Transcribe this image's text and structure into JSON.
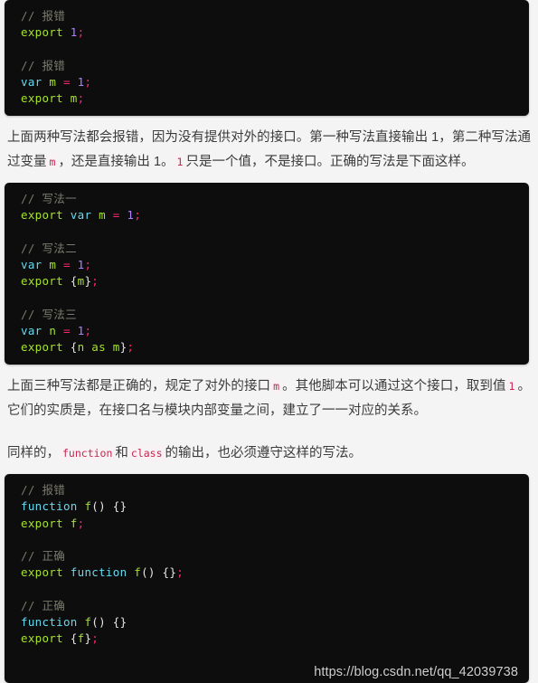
{
  "page": {
    "background_color": "#f4f4f4",
    "code_background_color": "#0d0d0d",
    "text_color": "#3b3b3b",
    "inline_code_color": "#c7254e",
    "inline_code_background": "#f9f2f4"
  },
  "code_block_1": {
    "lines": [
      {
        "segments": [
          {
            "t": "// 报错",
            "c": "com"
          }
        ]
      },
      {
        "segments": [
          {
            "t": "export",
            "c": "exp"
          },
          {
            "t": " ",
            "c": "pun"
          },
          {
            "t": "1",
            "c": "num"
          },
          {
            "t": ";",
            "c": "op"
          }
        ]
      },
      {
        "segments": []
      },
      {
        "segments": [
          {
            "t": "// 报错",
            "c": "com"
          }
        ]
      },
      {
        "segments": [
          {
            "t": "var",
            "c": "kw"
          },
          {
            "t": " ",
            "c": "pun"
          },
          {
            "t": "m",
            "c": "var"
          },
          {
            "t": " ",
            "c": "pun"
          },
          {
            "t": "=",
            "c": "op"
          },
          {
            "t": " ",
            "c": "pun"
          },
          {
            "t": "1",
            "c": "num"
          },
          {
            "t": ";",
            "c": "op"
          }
        ]
      },
      {
        "segments": [
          {
            "t": "export",
            "c": "exp"
          },
          {
            "t": " ",
            "c": "pun"
          },
          {
            "t": "m",
            "c": "var"
          },
          {
            "t": ";",
            "c": "op"
          }
        ]
      }
    ]
  },
  "paragraph_1": {
    "parts": [
      {
        "t": "上面两种写法都会报错，因为没有提供对外的接口。第一种写法直接输出 1，第二种写法通过变量",
        "code": false
      },
      {
        "t": "m",
        "code": true
      },
      {
        "t": "，还是直接输出 1。",
        "code": false
      },
      {
        "t": "1",
        "code": true
      },
      {
        "t": "只是一个值，不是接口。正确的写法是下面这样。",
        "code": false
      }
    ]
  },
  "code_block_2": {
    "lines": [
      {
        "segments": [
          {
            "t": "// 写法一",
            "c": "com"
          }
        ]
      },
      {
        "segments": [
          {
            "t": "export",
            "c": "exp"
          },
          {
            "t": " ",
            "c": "pun"
          },
          {
            "t": "var",
            "c": "kw"
          },
          {
            "t": " ",
            "c": "pun"
          },
          {
            "t": "m",
            "c": "var"
          },
          {
            "t": " ",
            "c": "pun"
          },
          {
            "t": "=",
            "c": "op"
          },
          {
            "t": " ",
            "c": "pun"
          },
          {
            "t": "1",
            "c": "num"
          },
          {
            "t": ";",
            "c": "op"
          }
        ]
      },
      {
        "segments": []
      },
      {
        "segments": [
          {
            "t": "// 写法二",
            "c": "com"
          }
        ]
      },
      {
        "segments": [
          {
            "t": "var",
            "c": "kw"
          },
          {
            "t": " ",
            "c": "pun"
          },
          {
            "t": "m",
            "c": "var"
          },
          {
            "t": " ",
            "c": "pun"
          },
          {
            "t": "=",
            "c": "op"
          },
          {
            "t": " ",
            "c": "pun"
          },
          {
            "t": "1",
            "c": "num"
          },
          {
            "t": ";",
            "c": "op"
          }
        ]
      },
      {
        "segments": [
          {
            "t": "export",
            "c": "exp"
          },
          {
            "t": " ",
            "c": "pun"
          },
          {
            "t": "{",
            "c": "pun"
          },
          {
            "t": "m",
            "c": "var"
          },
          {
            "t": "}",
            "c": "pun"
          },
          {
            "t": ";",
            "c": "op"
          }
        ]
      },
      {
        "segments": []
      },
      {
        "segments": [
          {
            "t": "// 写法三",
            "c": "com"
          }
        ]
      },
      {
        "segments": [
          {
            "t": "var",
            "c": "kw"
          },
          {
            "t": " ",
            "c": "pun"
          },
          {
            "t": "n",
            "c": "var"
          },
          {
            "t": " ",
            "c": "pun"
          },
          {
            "t": "=",
            "c": "op"
          },
          {
            "t": " ",
            "c": "pun"
          },
          {
            "t": "1",
            "c": "num"
          },
          {
            "t": ";",
            "c": "op"
          }
        ]
      },
      {
        "segments": [
          {
            "t": "export",
            "c": "exp"
          },
          {
            "t": " ",
            "c": "pun"
          },
          {
            "t": "{",
            "c": "pun"
          },
          {
            "t": "n",
            "c": "var"
          },
          {
            "t": " ",
            "c": "pun"
          },
          {
            "t": "as",
            "c": "exp"
          },
          {
            "t": " ",
            "c": "pun"
          },
          {
            "t": "m",
            "c": "var"
          },
          {
            "t": "}",
            "c": "pun"
          },
          {
            "t": ";",
            "c": "op"
          }
        ]
      }
    ]
  },
  "paragraph_2": {
    "parts": [
      {
        "t": "上面三种写法都是正确的，规定了对外的接口",
        "code": false
      },
      {
        "t": "m",
        "code": true
      },
      {
        "t": "。其他脚本可以通过这个接口，取到值",
        "code": false
      },
      {
        "t": "1",
        "code": true
      },
      {
        "t": "。它们的实质是，在接口名与模块内部变量之间，建立了一一对应的关系。",
        "code": false
      }
    ]
  },
  "paragraph_3": {
    "parts": [
      {
        "t": "同样的，",
        "code": false
      },
      {
        "t": "function",
        "code": true
      },
      {
        "t": "和",
        "code": false
      },
      {
        "t": "class",
        "code": true
      },
      {
        "t": "的输出，也必须遵守这样的写法。",
        "code": false
      }
    ]
  },
  "code_block_3": {
    "lines": [
      {
        "segments": [
          {
            "t": "// 报错",
            "c": "com"
          }
        ]
      },
      {
        "segments": [
          {
            "t": "function",
            "c": "kw"
          },
          {
            "t": " ",
            "c": "pun"
          },
          {
            "t": "f",
            "c": "var"
          },
          {
            "t": "() {}",
            "c": "pun"
          }
        ]
      },
      {
        "segments": [
          {
            "t": "export",
            "c": "exp"
          },
          {
            "t": " ",
            "c": "pun"
          },
          {
            "t": "f",
            "c": "var"
          },
          {
            "t": ";",
            "c": "op"
          }
        ]
      },
      {
        "segments": []
      },
      {
        "segments": [
          {
            "t": "// 正确",
            "c": "com"
          }
        ]
      },
      {
        "segments": [
          {
            "t": "export",
            "c": "exp"
          },
          {
            "t": " ",
            "c": "pun"
          },
          {
            "t": "function",
            "c": "kw"
          },
          {
            "t": " ",
            "c": "pun"
          },
          {
            "t": "f",
            "c": "var"
          },
          {
            "t": "() {}",
            "c": "pun"
          },
          {
            "t": ";",
            "c": "op"
          }
        ]
      },
      {
        "segments": []
      },
      {
        "segments": [
          {
            "t": "// 正确",
            "c": "com"
          }
        ]
      },
      {
        "segments": [
          {
            "t": "function",
            "c": "kw"
          },
          {
            "t": " ",
            "c": "pun"
          },
          {
            "t": "f",
            "c": "var"
          },
          {
            "t": "() {}",
            "c": "pun"
          }
        ]
      },
      {
        "segments": [
          {
            "t": "export",
            "c": "exp"
          },
          {
            "t": " ",
            "c": "pun"
          },
          {
            "t": "{",
            "c": "pun"
          },
          {
            "t": "f",
            "c": "var"
          },
          {
            "t": "}",
            "c": "pun"
          },
          {
            "t": ";",
            "c": "op"
          }
        ]
      }
    ]
  },
  "watermark": {
    "text": "https://blog.csdn.net/qq_42039738"
  }
}
